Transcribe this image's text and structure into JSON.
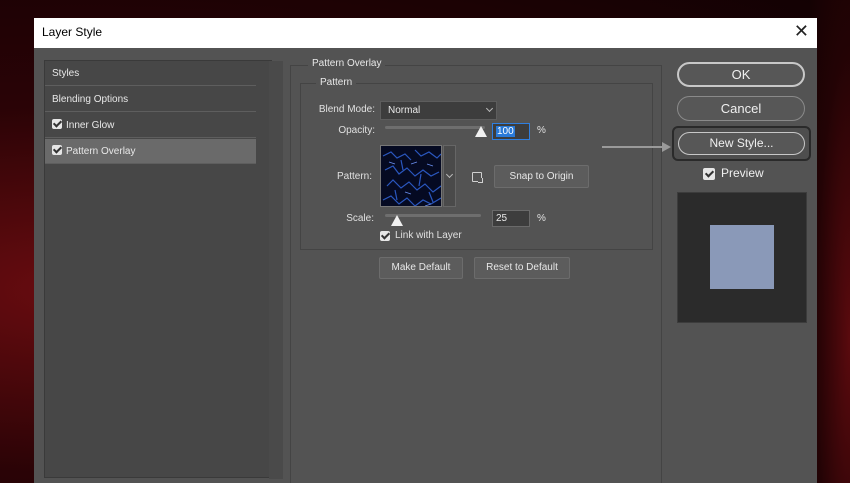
{
  "window": {
    "title": "Layer Style",
    "close_glyph": "✕"
  },
  "styles_list": [
    {
      "label": "Styles",
      "checked": false,
      "selected": false
    },
    {
      "label": "Blending Options",
      "checked": false,
      "selected": false
    },
    {
      "label": "Inner Glow",
      "checked": true,
      "selected": false
    },
    {
      "label": "Pattern Overlay",
      "checked": true,
      "selected": true
    }
  ],
  "section": {
    "title": "Pattern Overlay",
    "group_title": "Pattern",
    "blend_mode_label": "Blend Mode:",
    "blend_mode_value": "Normal",
    "opacity_label": "Opacity:",
    "opacity_value": "100",
    "opacity_unit": "%",
    "opacity_level": 1.0,
    "pattern_label": "Pattern:",
    "snap_button": "Snap to Origin",
    "scale_label": "Scale:",
    "scale_value": "25",
    "scale_unit": "%",
    "scale_level": 0.05,
    "link_label": "Link with Layer",
    "link_checked": true,
    "make_default": "Make Default",
    "reset_default": "Reset to Default"
  },
  "actions": {
    "ok": "OK",
    "cancel": "Cancel",
    "new_style": "New Style...",
    "preview_label": "Preview",
    "preview_checked": true
  },
  "colors": {
    "dialog_bg": "#535353",
    "preview_swatch": "#8a99b8",
    "pattern_bg": "#050a22",
    "pattern_line": "#2f5fd0"
  },
  "icons": {
    "pattern_dropdown": "chevron-down-icon",
    "new_preset": "new-preset-icon",
    "pointer_arrow": "arrow-right-icon"
  }
}
